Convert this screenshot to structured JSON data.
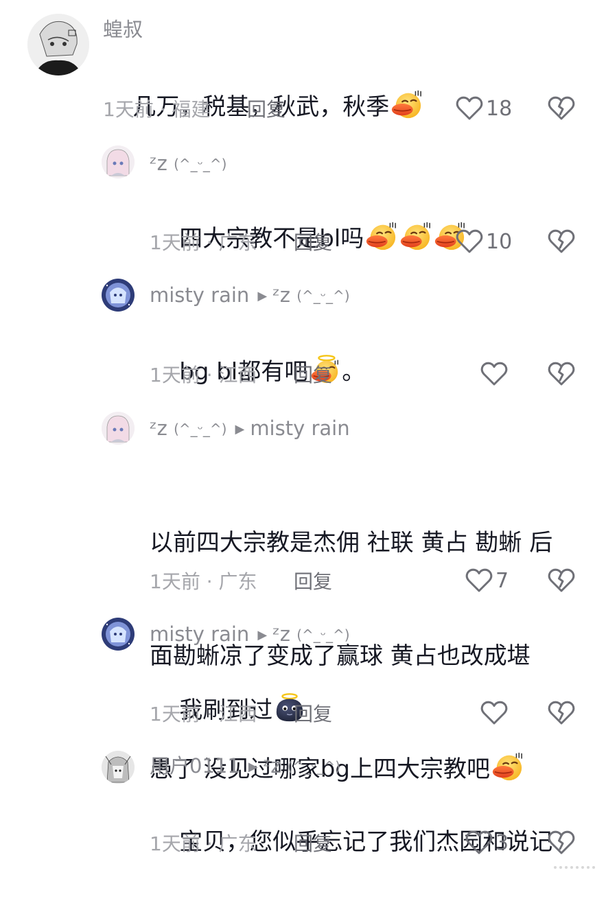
{
  "comments": [
    {
      "username": "蝗叔",
      "reply_to": "",
      "text": "几万，税基，秋武，秋季",
      "emojis": [
        "smirk-duck-emoji"
      ],
      "time_location": "1天前 · 福建",
      "reply_label": "回复",
      "likes": "18"
    },
    {
      "username": "ᶻz",
      "username_suffix": "(^_ᵕ_^)",
      "reply_to": "",
      "text": "四大宗教不是bl吗",
      "emojis": [
        "smirk-duck-emoji",
        "smirk-duck-emoji",
        "smirk-duck-emoji"
      ],
      "time_location": "1天前 · 广东",
      "reply_label": "回复",
      "likes": "10"
    },
    {
      "username": "misty rain",
      "reply_to": "ᶻz",
      "reply_to_suffix": "(^_ᵕ_^)",
      "text": "bg bl都有吧",
      "text_after": "。",
      "emojis": [
        "angel-duck-emoji"
      ],
      "time_location": "1天前 · 江西",
      "reply_label": "回复",
      "likes": ""
    },
    {
      "username": "ᶻz",
      "username_suffix": "(^_ᵕ_^)",
      "reply_to": "misty rain",
      "text_lines": [
        "以前四大宗教是杰佣 社联 黄占 勘蜥 后",
        "面勘蜥凉了变成了赢球 黄占也改成堪",
        "愚了 没见过哪家bg上四大宗教吧"
      ],
      "emojis": [
        "smirk-duck-emoji"
      ],
      "time_location": "1天前 · 广东",
      "reply_label": "回复",
      "likes": "7"
    },
    {
      "username": "misty rain",
      "reply_to": "ᶻz",
      "reply_to_suffix": "(^_ᵕ_^)",
      "text": "我刷到过",
      "emojis": [
        "angel-blob-emoji"
      ],
      "time_location": "1天前 · 江西",
      "reply_label": "回复",
      "likes": ""
    },
    {
      "username": "用户0111",
      "reply_to": "ᶻz",
      "reply_to_suffix": "(^_ᵕ_^)",
      "text": "宝贝，您似乎忘记了我们杰园和说记",
      "emojis": [],
      "time_location": "1天前 · 广东",
      "reply_label": "回复",
      "likes": "3"
    }
  ],
  "icons": {
    "like": "heart-outline-icon",
    "dislike": "broken-heart-icon",
    "reply_arrow": "play-arrow-icon"
  },
  "colors": {
    "text": "#161823",
    "meta": "#a5a6ab",
    "username": "#8a8b91",
    "icon": "#6f7077"
  }
}
